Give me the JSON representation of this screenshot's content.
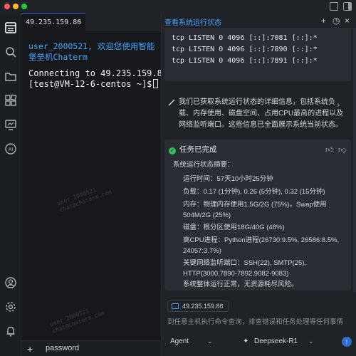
{
  "window": {
    "controls": [
      "close",
      "minimize",
      "maximize"
    ],
    "right_icons": [
      "split-layout-icon",
      "panel-toggle-icon"
    ]
  },
  "activity_bar": {
    "top": [
      "terminal-icon",
      "search-icon",
      "folder-icon",
      "extensions-icon",
      "remote-monitor-icon",
      "ai-icon"
    ],
    "bottom": [
      "user-icon",
      "gear-icon",
      "bell-icon"
    ]
  },
  "terminal": {
    "tab_label": "49.235.159.86",
    "welcome": "user_2000521, 欢迎您使用智能堡垒机Chaterm",
    "connecting": "Connecting to 49.235.159.86",
    "prompt": "[test@VM-12-6-centos ~]$",
    "watermark": "user_2000521\nchat@chaterm.com",
    "footer_input": "password"
  },
  "panel": {
    "title": "查看系统运行状态",
    "code_lines": [
      "tcp LISTEN 0 4096 [::]:7081 [::]:*",
      "tcp LISTEN 0 4096 [::]:7890 [::]:*",
      "tcp LISTEN 0 4096 [::]:7891 [::]:*"
    ],
    "assistant_message": "我们已获取系统运行状态的详细信息，包括系统负载、内存使用、磁盘空间、占用CPU最高的进程以及网络监听端口。这些信息已全面展示系统当前状态。",
    "done_title": "任务已完成",
    "summary_title": "系统运行状态摘要：",
    "summary_items": [
      "运行时间：57天10小时25分钟",
      "负载：0.17 (1分钟), 0.26 (5分钟), 0.32 (15分钟)",
      "内存：物理内存使用1.5G/2G (75%)，Swap使用504M/2G (25%)",
      "磁盘：根分区使用18G/40G (48%)",
      "高CPU进程：Python进程(26730:9.5%, 26586:8.5%, 24057:3.7%)",
      "关键网络监听端口：SSH(22), SMTP(25), HTTP(3000,7890-7892,9082-9083)",
      "系统整体运行正常，无资源耗尽风险。"
    ],
    "host_chip": "49.235.159.86",
    "input_placeholder": "到任意主机执行命令查询，排查错误和任务处理等任何事情",
    "mode": "Agent",
    "model": "Deepseek-R1"
  }
}
